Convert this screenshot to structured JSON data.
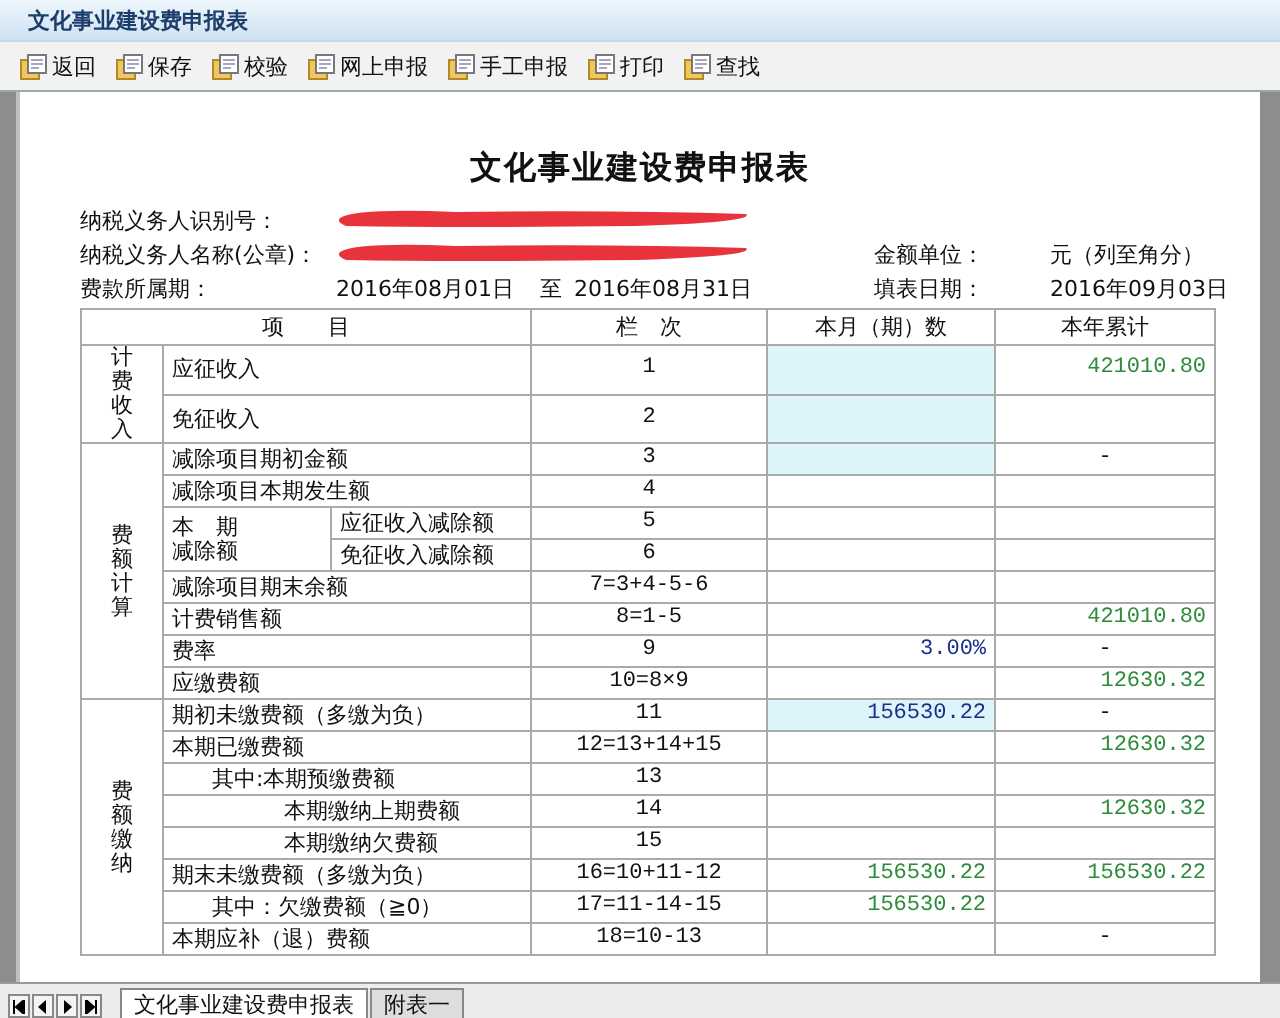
{
  "window": {
    "title": "文化事业建设费申报表"
  },
  "toolbar": [
    "返回",
    "保存",
    "校验",
    "网上申报",
    "手工申报",
    "打印",
    "查找"
  ],
  "form": {
    "title": "文化事业建设费申报表",
    "taxpayer_id": {
      "label": "纳税义务人识别号：",
      "redacted": true
    },
    "taxpayer_name": {
      "label": "纳税义务人名称(公章)：",
      "redacted": true
    },
    "amount_unit": {
      "label": "金额单位：",
      "value": "元（列至角分）"
    },
    "period": {
      "label": "费款所属期：",
      "from": "2016年08月01日",
      "to_label": "至",
      "to": "2016年08月31日"
    },
    "fill_date": {
      "label": "填表日期：",
      "value": "2016年09月03日"
    },
    "columns": [
      "项　　目",
      "栏　次",
      "本月（期）数",
      "本年累计"
    ],
    "groups": [
      {
        "label": "计费收入",
        "rows": [
          {
            "item": "应征收入",
            "kind": "tall",
            "line": "1",
            "input": true,
            "ytd": {
              "text": "421010.80",
              "kind": "computed"
            }
          },
          {
            "item": "免征收入",
            "kind": "tall",
            "line": "2",
            "input": true
          }
        ]
      },
      {
        "label": "费额计算",
        "rows": [
          {
            "item": "减除项目期初金额",
            "kind": "main",
            "line": "3",
            "input": true,
            "ytd": {
              "text": "-",
              "kind": "dash"
            }
          },
          {
            "item": "减除项目本期发生额",
            "kind": "main",
            "line": "4",
            "input": false
          },
          {
            "item": "本　期减除额",
            "kind": "split",
            "input": false,
            "children": [
              {
                "item": "应征收入减除额",
                "line": "5"
              },
              {
                "item": "免征收入减除额",
                "line": "6"
              }
            ]
          },
          {
            "item": "减除项目期末余额",
            "kind": "main",
            "line": "7=3+4-5-6",
            "input": false
          },
          {
            "item": "计费销售额",
            "kind": "main",
            "line": "8=1-5",
            "input": false,
            "ytd": {
              "text": "421010.80",
              "kind": "computed"
            }
          },
          {
            "item": "费率",
            "kind": "main",
            "line": "9",
            "input": false,
            "current": {
              "text": "3.00%",
              "kind": "entered"
            },
            "ytd": {
              "text": "-",
              "kind": "dash"
            }
          },
          {
            "item": "应缴费额",
            "kind": "main",
            "line": "10=8×9",
            "input": false,
            "ytd": {
              "text": "12630.32",
              "kind": "computed"
            }
          }
        ]
      },
      {
        "label": "费额缴纳",
        "rows": [
          {
            "item": "期初未缴费额（多缴为负）",
            "kind": "main",
            "line": "11",
            "input": true,
            "current": {
              "text": "156530.22",
              "kind": "entered"
            },
            "ytd": {
              "text": "-",
              "kind": "dash"
            }
          },
          {
            "item": "本期已缴费额",
            "kind": "main",
            "line": "12=13+14+15",
            "input": false,
            "ytd": {
              "text": "12630.32",
              "kind": "computed"
            }
          },
          {
            "item": "其中:本期预缴费额",
            "kind": "detail_first",
            "line": "13",
            "input": false
          },
          {
            "item": "本期缴纳上期费额",
            "kind": "detail",
            "line": "14",
            "input": false,
            "ytd": {
              "text": "12630.32",
              "kind": "computed"
            }
          },
          {
            "item": "本期缴纳欠费额",
            "kind": "detail",
            "line": "15",
            "input": false
          },
          {
            "item": "期末未缴费额（多缴为负）",
            "kind": "main",
            "line": "16=10+11-12",
            "input": false,
            "current": {
              "text": "156530.22",
              "kind": "computed"
            },
            "ytd": {
              "text": "156530.22",
              "kind": "computed"
            }
          },
          {
            "item": "其中：欠缴费额（≧0）",
            "kind": "detail_first",
            "line": "17=11-14-15",
            "input": false,
            "current": {
              "text": "156530.22",
              "kind": "computed"
            }
          },
          {
            "item": "本期应补（退）费额",
            "kind": "main",
            "line": "18=10-13",
            "input": false,
            "ytd": {
              "text": "-",
              "kind": "dash"
            }
          }
        ]
      }
    ]
  },
  "sheet_tabs": [
    {
      "label": "文化事业建设费申报表",
      "selected": true
    },
    {
      "label": "附表一",
      "selected": false
    }
  ]
}
